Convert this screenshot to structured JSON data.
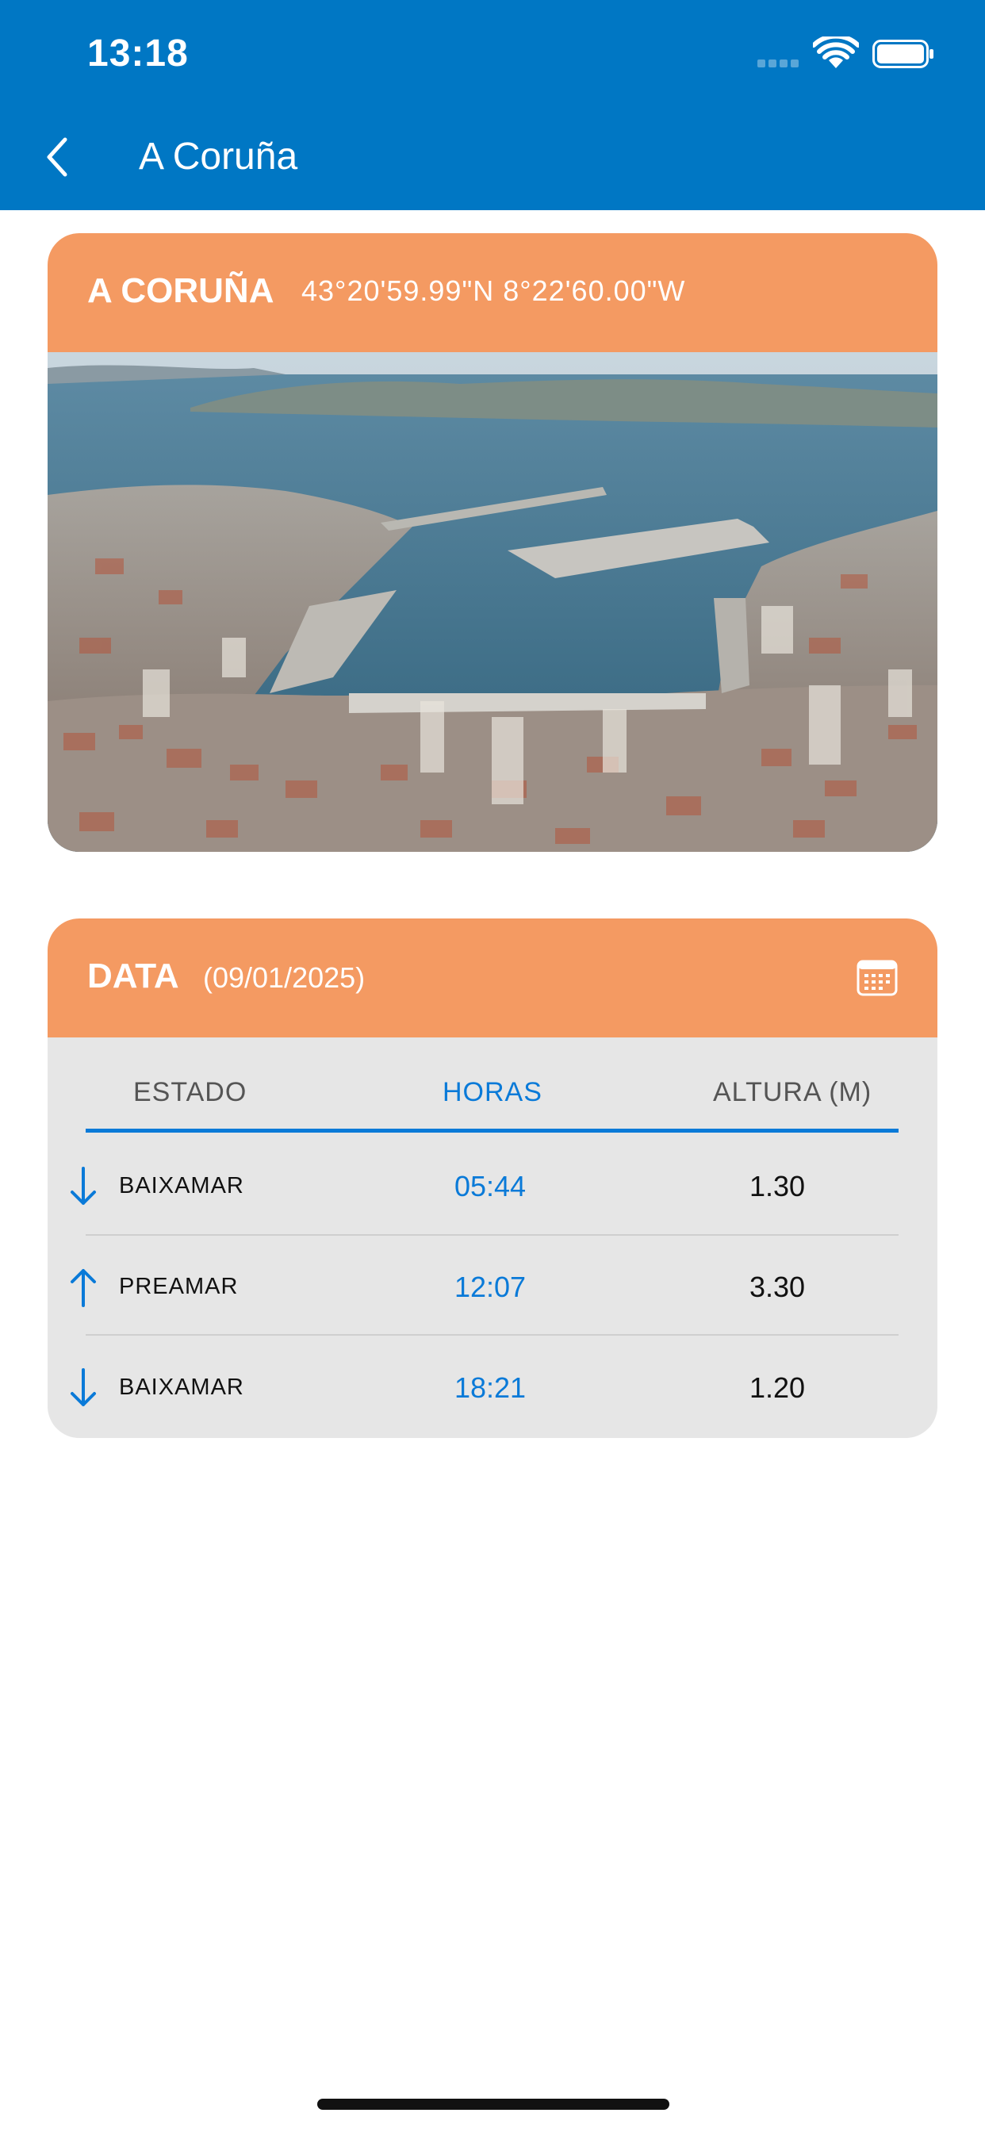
{
  "status_bar": {
    "time": "13:18"
  },
  "nav": {
    "title": "A Coruña"
  },
  "location_card": {
    "name": "A CORUÑA",
    "coordinates": "43°20'59.99\"N  8°22'60.00\"W"
  },
  "tide_card": {
    "label": "DATA",
    "date": "(09/01/2025)",
    "columns": {
      "state": "ESTADO",
      "hours": "HORAS",
      "height": "ALTURA (M)"
    },
    "rows": [
      {
        "direction": "down",
        "state": "BAIXAMAR",
        "time": "05:44",
        "height": "1.30"
      },
      {
        "direction": "up",
        "state": "PREAMAR",
        "time": "12:07",
        "height": "3.30"
      },
      {
        "direction": "down",
        "state": "BAIXAMAR",
        "time": "18:21",
        "height": "1.20"
      }
    ]
  },
  "colors": {
    "header": "#0077c4",
    "accent": "#f49a62",
    "link": "#0a7ad8",
    "table_bg": "#e6e6e6"
  }
}
